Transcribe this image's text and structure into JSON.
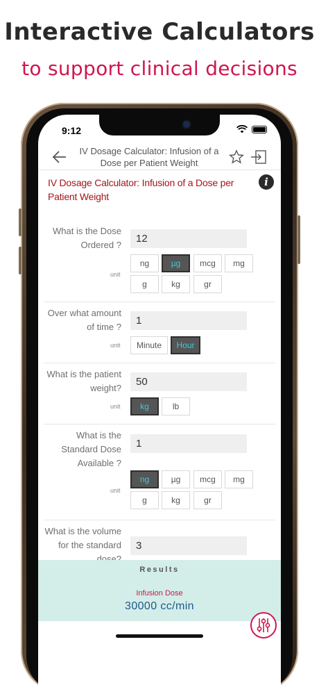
{
  "promo": {
    "title": "Interactive Calculators",
    "subtitle": "to support clinical decisions"
  },
  "status_bar": {
    "time": "9:12"
  },
  "nav": {
    "title": "IV Dosage Calculator: Infusion of a Dose per Patient Weight",
    "icons": [
      "back-arrow-icon",
      "star-icon",
      "exit-icon"
    ]
  },
  "calculator": {
    "title": "IV Dosage Calculator: Infusion of a Dose per Patient Weight",
    "info_icon": "i"
  },
  "fields": {
    "dose_ordered": {
      "label": "What is the Dose Ordered ?",
      "value": "12",
      "unit_label": "unit",
      "units": [
        "ng",
        "µg",
        "mcg",
        "mg",
        "g",
        "kg",
        "gr"
      ],
      "selected": "µg"
    },
    "time": {
      "label": "Over what amount of time ?",
      "value": "1",
      "unit_label": "unit",
      "units": [
        "Minute",
        "Hour"
      ],
      "selected": "Hour"
    },
    "weight": {
      "label": "What is the patient weight?",
      "value": "50",
      "unit_label": "unit",
      "units": [
        "kg",
        "lb"
      ],
      "selected": "kg"
    },
    "standard_dose": {
      "label": "What is the Standard Dose Available ?",
      "value": "1",
      "unit_label": "unit",
      "units": [
        "ng",
        "µg",
        "mcg",
        "mg",
        "g",
        "kg",
        "gr"
      ],
      "selected": "ng"
    },
    "volume": {
      "label": "What is the volume for the standard dose?",
      "value": "3"
    }
  },
  "results": {
    "title": "Results",
    "infusion_label": "Infusion Dose",
    "infusion_value": "30000 cc/min"
  },
  "colors": {
    "accent": "#d0154f",
    "title_red": "#a31419",
    "selected_bg": "#555555",
    "selected_text": "#3ec9d8",
    "results_bg": "#d3ede9",
    "result_value": "#1c5a8a"
  }
}
